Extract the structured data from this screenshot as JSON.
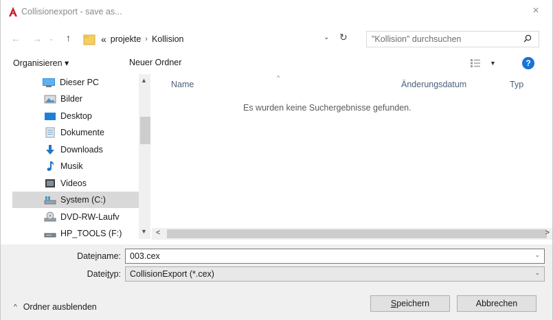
{
  "window": {
    "title": "Collisionexport - save as...",
    "close_glyph": "×",
    "app_icon": "autodesk-a-icon",
    "accent": "#c8202f"
  },
  "address": {
    "back_glyph": "←",
    "forward_glyph": "→",
    "history_glyph": "⌄",
    "up_glyph": "↑",
    "overflow": "«",
    "crumbs": [
      "projekte",
      "Kollision"
    ],
    "separator": "›",
    "dropdown_glyph": "⌄",
    "refresh_glyph": "↻",
    "search_placeholder": "\"Kollision\" durchsuchen"
  },
  "toolbar": {
    "organize": "Organisieren ▾",
    "new_folder": "Neuer Ordner",
    "view_dropdown": "▼",
    "help": "?"
  },
  "nav": {
    "items": [
      {
        "label": "Dieser PC",
        "icon": "pc-icon"
      },
      {
        "label": "Bilder",
        "icon": "pictures-icon"
      },
      {
        "label": "Desktop",
        "icon": "desktop-icon"
      },
      {
        "label": "Dokumente",
        "icon": "documents-icon"
      },
      {
        "label": "Downloads",
        "icon": "downloads-icon"
      },
      {
        "label": "Musik",
        "icon": "music-icon"
      },
      {
        "label": "Videos",
        "icon": "videos-icon"
      },
      {
        "label": "System (C:)",
        "icon": "drive-icon",
        "selected": true
      },
      {
        "label": "DVD-RW-Laufv",
        "icon": "dvd-icon"
      },
      {
        "label": "HP_TOOLS (F:)",
        "icon": "usb-drive-icon"
      }
    ],
    "scroll_up": "▲",
    "scroll_down": "▼"
  },
  "content": {
    "sort_glyph": "^",
    "columns": [
      "Name",
      "Änderungsdatum",
      "Typ"
    ],
    "empty_message": "Es wurden keine Suchergebnisse gefunden.",
    "scroll_left": "<",
    "scroll_right": ">"
  },
  "form": {
    "filename_label_pre": "Date",
    "filename_label_ul": "i",
    "filename_label_post": "name:",
    "filename_value": "003.cex",
    "filetype_label_pre": "Datei",
    "filetype_label_ul": "t",
    "filetype_label_post": "yp:",
    "filetype_value": "CollisionExport (*.cex)",
    "dropdown_glyph": "⌄"
  },
  "footer": {
    "hide_folders": "Ordner ausblenden",
    "hide_glyph": "^",
    "save_ul": "S",
    "save_rest": "peichern",
    "cancel": "Abbrechen"
  }
}
